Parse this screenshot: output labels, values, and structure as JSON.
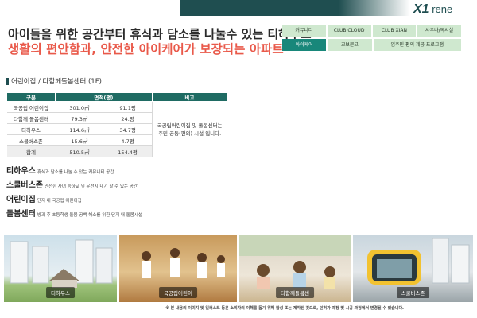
{
  "brand": {
    "logo_mark": "X1",
    "logo_text": "rene"
  },
  "headline": {
    "line1": "아이들을 위한 공간부터 휴식과 담소를 나눌수 있는 티하우스",
    "line2": "생활의 편안함과, 안전한 아이케어가 보장되는 아파트"
  },
  "nav": {
    "row1": [
      "커뮤니티",
      "CLUB CLOUD",
      "CLUB XIAN",
      "사우나/독서실"
    ],
    "row2": [
      "아이케어",
      "교보문고",
      "입주민 편의 제공 프로그램"
    ]
  },
  "section": {
    "title": "어린이집 / 다함께돌봄센터 (1F)"
  },
  "table": {
    "headers": [
      "구분",
      "면적(평)",
      "비고"
    ],
    "rows": [
      {
        "name": "국공립 어린이집",
        "sqm": "301.0㎡",
        "pyeong": "91.1평"
      },
      {
        "name": "다함께 돌봄센터",
        "sqm": "79.3㎡",
        "pyeong": "24.평"
      },
      {
        "name": "티하우스",
        "sqm": "114.6㎡",
        "pyeong": "34.7평"
      },
      {
        "name": "스쿨버스존",
        "sqm": "15.6㎡",
        "pyeong": "4.7평"
      }
    ],
    "total": {
      "name": "합계",
      "sqm": "510.5㎡",
      "pyeong": "154.4평"
    },
    "note": "국공립어린이집 및 돌봄센터는 주민 공동(편의) 시설 입니다."
  },
  "items": [
    {
      "title": "티하우스",
      "desc": "휴식과 담소를 나눌 수 있는 커뮤니티 공간"
    },
    {
      "title": "스쿨버스존",
      "desc": "안전한 자녀 등하교 및 우천시 대기 할 수 있는 공간"
    },
    {
      "title": "어린이집",
      "desc": "단지 내 국공립 어린이집"
    },
    {
      "title": "돌봄센터",
      "desc": "방과 후 초등학생 돌봄 공백 해소를 위한 단지 내 돌봄시설"
    }
  ],
  "photos": [
    "티하우스",
    "국공립어린이",
    "다함께돌봄센",
    "스쿨버스존"
  ],
  "disclaimer": "※ 본 내용의 이미지 및 일러스트 등은 소비자의 이해를 돕기 위해 합성 또는 제작된 것으로, 인허가 과정 및 시공 과정에서 변경될 수 있습니다."
}
